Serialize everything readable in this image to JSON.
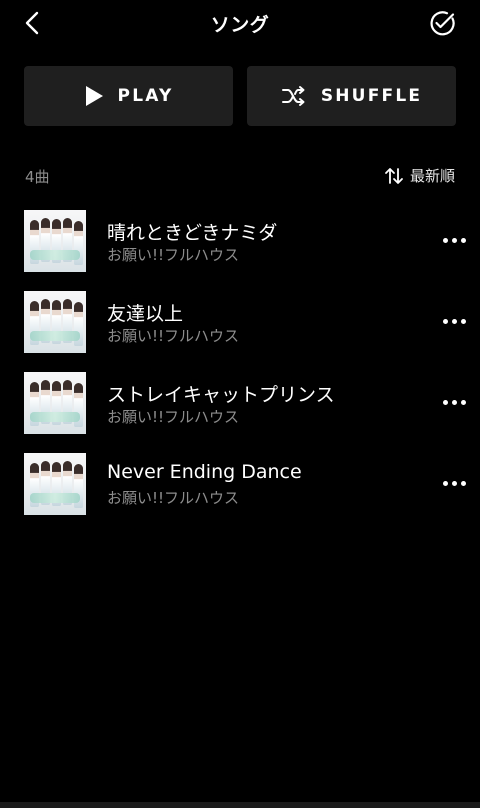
{
  "header": {
    "title": "ソング",
    "back_icon": "chevron-left-icon",
    "select_icon": "check-circle-icon"
  },
  "actions": {
    "play_label": "PLAY",
    "play_icon": "play-icon",
    "shuffle_label": "SHUFFLE",
    "shuffle_icon": "shuffle-icon"
  },
  "list_info": {
    "count": "4曲",
    "sort_label": "最新順",
    "sort_icon": "sort-arrows-icon"
  },
  "songs": [
    {
      "title": "晴れときどきナミダ",
      "artist": "お願い!!フルハウス"
    },
    {
      "title": "友達以上",
      "artist": "お願い!!フルハウス"
    },
    {
      "title": "ストレイキャットプリンス",
      "artist": "お願い!!フルハウス"
    },
    {
      "title": "Never Ending Dance",
      "artist": "お願い!!フルハウス"
    }
  ],
  "colors": {
    "background": "#000000",
    "button_bg": "#1f1f1f",
    "secondary_text": "#8d8d8d"
  }
}
